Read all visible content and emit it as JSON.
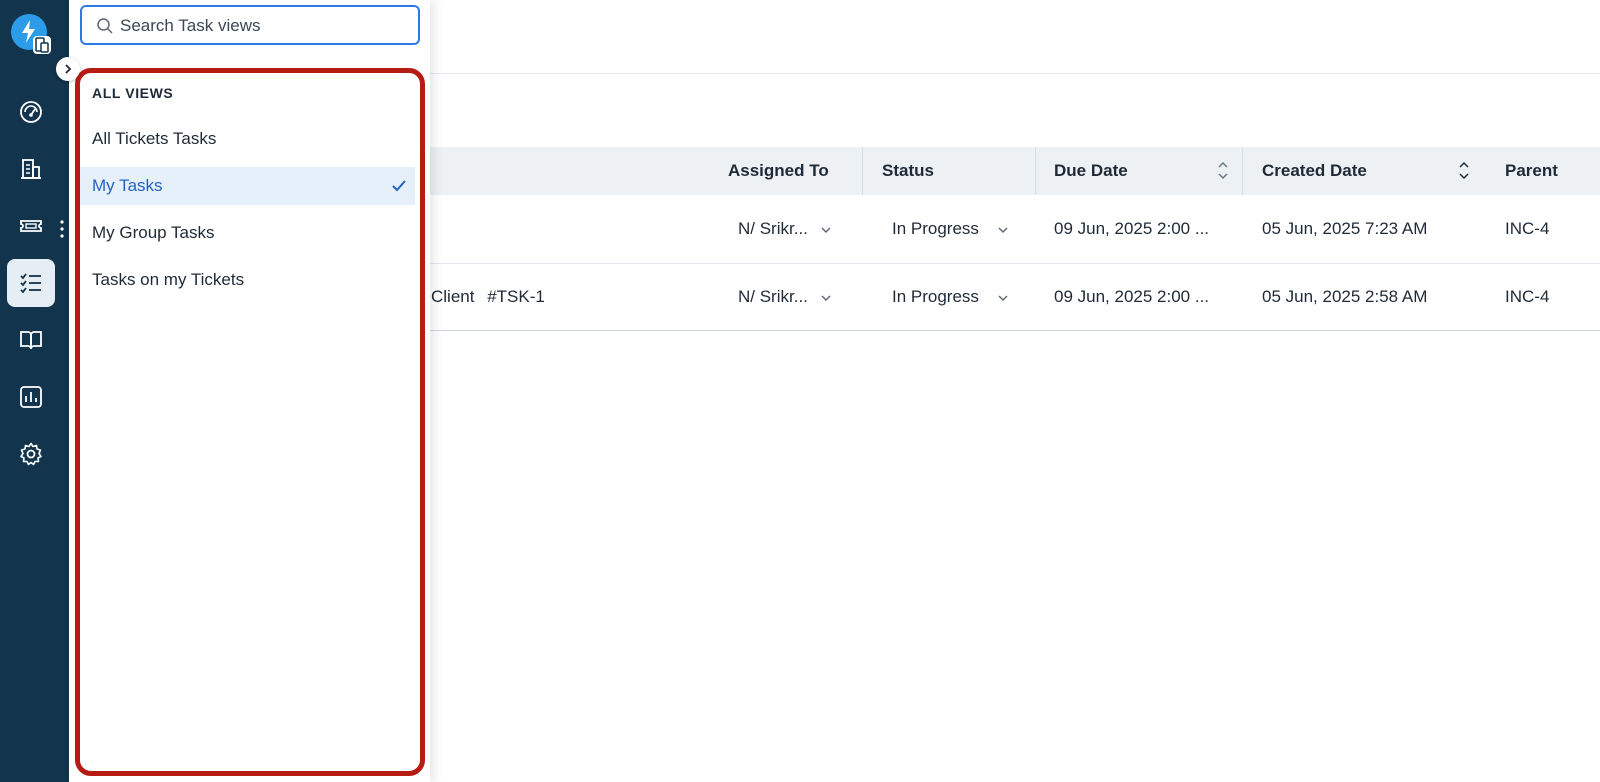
{
  "colors": {
    "rail_bg": "#12344d",
    "accent": "#2c7be5",
    "selected_bg": "#e5f0fb",
    "highlight_border": "#b71c14"
  },
  "nav": {
    "items": [
      {
        "icon": "dashboard-icon"
      },
      {
        "icon": "building-icon"
      },
      {
        "icon": "ticket-icon"
      },
      {
        "icon": "tasks-icon",
        "active": true
      },
      {
        "icon": "book-icon"
      },
      {
        "icon": "reports-icon"
      },
      {
        "icon": "gear-icon"
      }
    ]
  },
  "views_panel": {
    "search_placeholder": "Search Task views",
    "search_value": "",
    "heading": "ALL VIEWS",
    "items": [
      {
        "label": "All Tickets Tasks",
        "selected": false
      },
      {
        "label": "My Tasks",
        "selected": true
      },
      {
        "label": "My Group Tasks",
        "selected": false
      },
      {
        "label": "Tasks on my Tickets",
        "selected": false
      }
    ]
  },
  "table": {
    "columns": [
      "Assigned To",
      "Status",
      "Due Date",
      "Created Date",
      "Parent"
    ],
    "rows": [
      {
        "title": "",
        "assigned_to": "N/ Srikr...",
        "status": "In Progress",
        "due_date": "09 Jun, 2025 2:00 ...",
        "created_date": "05 Jun, 2025 7:23 AM",
        "parent": "INC-4"
      },
      {
        "title": "Client",
        "task_id": "#TSK-1",
        "assigned_to": "N/ Srikr...",
        "status": "In Progress",
        "due_date": "09 Jun, 2025 2:00 ...",
        "created_date": "05 Jun, 2025 2:58 AM",
        "parent": "INC-4"
      }
    ]
  }
}
